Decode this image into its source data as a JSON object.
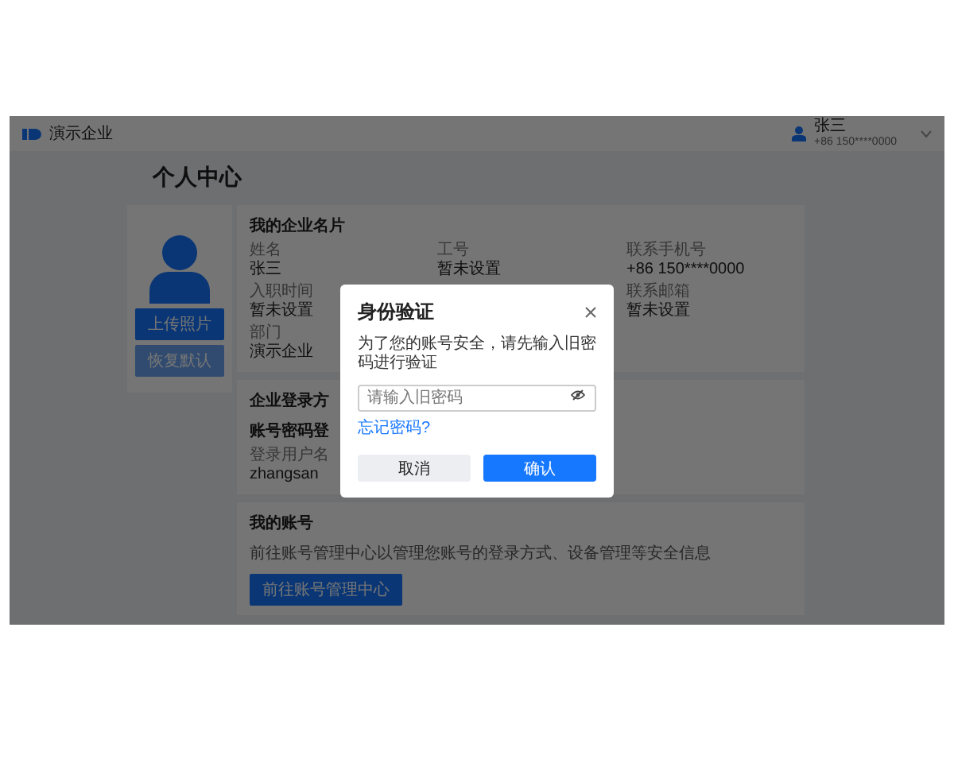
{
  "header": {
    "company": "演示企业",
    "user": {
      "name": "张三",
      "phone": "+86 150****0000"
    }
  },
  "page_title": "个人中心",
  "avatar_card": {
    "buttons": [
      {
        "label": "上传照片",
        "disabled": false
      },
      {
        "label": "恢复默认",
        "disabled": true
      }
    ]
  },
  "business_card": {
    "title": "我的企业名片",
    "columns": [
      [
        {
          "label": "姓名",
          "value": "张三"
        },
        {
          "label": "入职时间",
          "value": "暂未设置"
        },
        {
          "label": "部门",
          "value": "演示企业"
        }
      ],
      [
        {
          "label": "工号",
          "value": "暂未设置"
        }
      ],
      [
        {
          "label": "联系手机号",
          "value": "+86 150****0000"
        },
        {
          "label": "联系邮箱",
          "value": "暂未设置"
        }
      ]
    ]
  },
  "login_section": {
    "title": "企业登录方",
    "subtitle": "账号密码登",
    "field": {
      "label": "登录用户名",
      "value": "zhangsan"
    }
  },
  "account_section": {
    "title": "我的账号",
    "description": "前往账号管理中心以管理您账号的登录方式、设备管理等安全信息",
    "button": "前往账号管理中心"
  },
  "dialog": {
    "title": "身份验证",
    "description": "为了您的账号安全，请先输入旧密码进行验证",
    "input": {
      "placeholder": "请输入旧密码"
    },
    "link": "忘记密码?",
    "buttons": [
      {
        "label": "取消",
        "kind": "secondary"
      },
      {
        "label": "确认",
        "kind": "primary"
      }
    ]
  }
}
